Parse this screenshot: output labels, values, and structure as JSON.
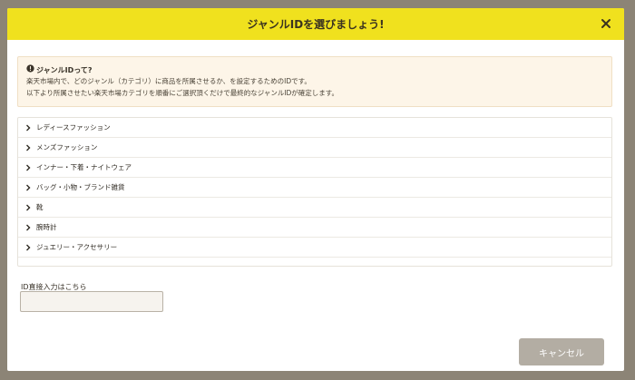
{
  "modal": {
    "title": "ジャンルIDを選びましょう!",
    "close_icon": "close-icon"
  },
  "info": {
    "icon": "info-circle-icon",
    "title": "ジャンルIDって?",
    "lines": [
      "楽天市場内で、どのジャンル（カテゴリ）に商品を所属させるか、を設定するためのIDです。",
      "以下より所属させたい楽天市場カテゴリを順番にご選択頂くだけで最終的なジャンルIDが確定します。"
    ]
  },
  "genres": [
    "レディースファッション",
    "メンズファッション",
    "インナー・下着・ナイトウェア",
    "バッグ・小物・ブランド雑貨",
    "靴",
    "腕時計",
    "ジュエリー・アクセサリー"
  ],
  "id_input": {
    "label": "ID直接入力はこちら",
    "value": "",
    "placeholder": ""
  },
  "footer": {
    "cancel_label": "キャンセル"
  },
  "colors": {
    "header": "#f0e11e",
    "info_bg": "#fdf5e8",
    "cancel_bg": "#b3ada3",
    "overlay": "#8c8476"
  }
}
